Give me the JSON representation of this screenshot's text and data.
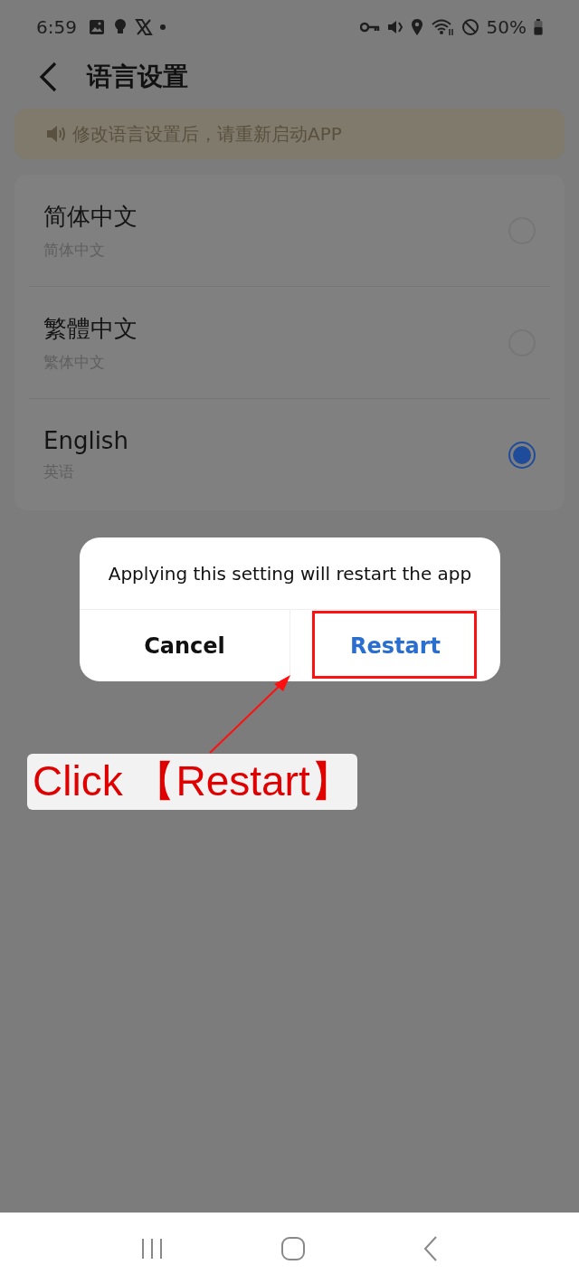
{
  "status_bar": {
    "time": "6:59",
    "battery": "50%"
  },
  "header": {
    "title": "语言设置"
  },
  "notice": {
    "text": "修改语言设置后，请重新启动APP"
  },
  "languages": [
    {
      "name": "简体中文",
      "subtitle": "简体中文",
      "selected": false
    },
    {
      "name": "繁體中文",
      "subtitle": "繁体中文",
      "selected": false
    },
    {
      "name": "English",
      "subtitle": "英语",
      "selected": true
    }
  ],
  "dialog": {
    "message": "Applying this setting will restart the app",
    "buttons": [
      {
        "label": "Cancel",
        "kind": "cancel"
      },
      {
        "label": "Restart",
        "kind": "confirm"
      }
    ]
  },
  "annotation": {
    "text": "Click 【Restart】"
  }
}
